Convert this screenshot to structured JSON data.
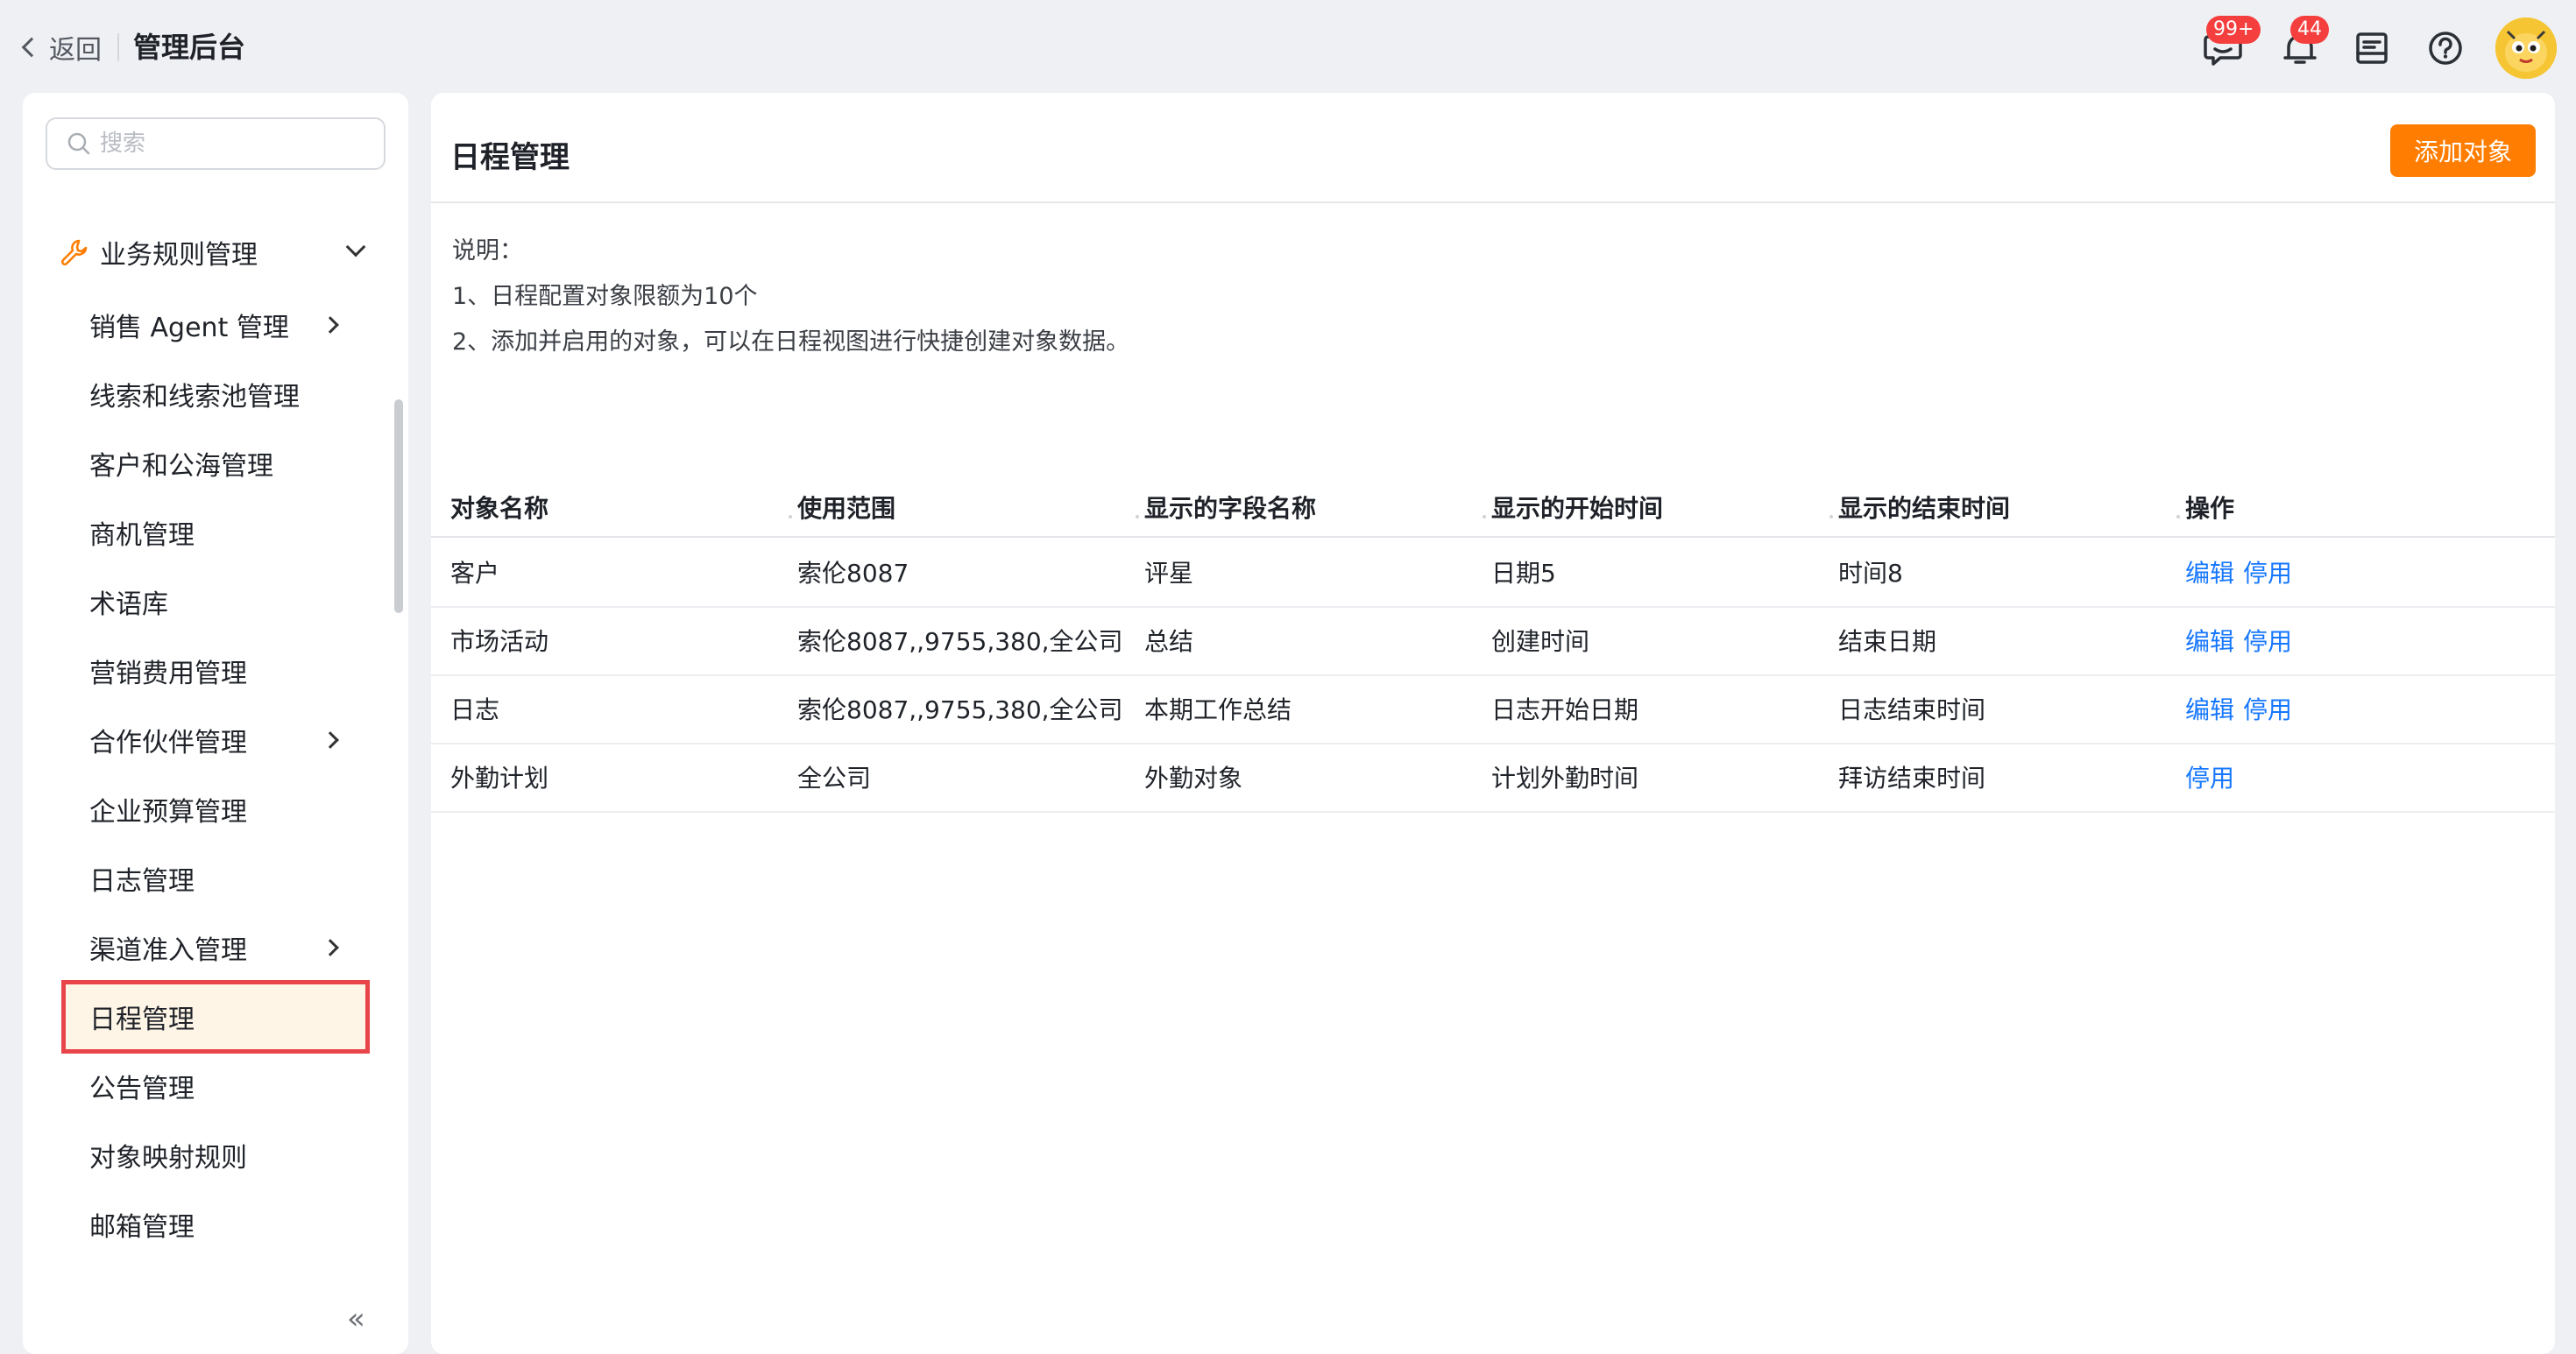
{
  "topbar": {
    "back_label": "返回",
    "title": "管理后台",
    "message_badge": "99+",
    "notice_badge": "44"
  },
  "sidebar": {
    "search_placeholder": "搜索",
    "group_label": "业务规则管理",
    "items": [
      {
        "label": "销售 Agent 管理",
        "has_children": true
      },
      {
        "label": "线索和线索池管理",
        "has_children": false
      },
      {
        "label": "客户和公海管理",
        "has_children": false
      },
      {
        "label": "商机管理",
        "has_children": false
      },
      {
        "label": "术语库",
        "has_children": false
      },
      {
        "label": "营销费用管理",
        "has_children": false
      },
      {
        "label": "合作伙伴管理",
        "has_children": true
      },
      {
        "label": "企业预算管理",
        "has_children": false
      },
      {
        "label": "日志管理",
        "has_children": false
      },
      {
        "label": "渠道准入管理",
        "has_children": true
      },
      {
        "label": "日程管理",
        "has_children": false,
        "active": true
      },
      {
        "label": "公告管理",
        "has_children": false
      },
      {
        "label": "对象映射规则",
        "has_children": false
      },
      {
        "label": "邮箱管理",
        "has_children": false
      }
    ],
    "collapse_glyph": "«"
  },
  "main": {
    "title": "日程管理",
    "add_button": "添加对象",
    "notes": [
      "说明：",
      "1、日程配置对象限额为10个",
      "2、添加并启用的对象，可以在日程视图进行快捷创建对象数据。"
    ],
    "columns": [
      "对象名称",
      "使用范围",
      "显示的字段名称",
      "显示的开始时间",
      "显示的结束时间",
      "操作"
    ],
    "rows": [
      {
        "name": "客户",
        "scope": "索伦8087",
        "field": "评星",
        "start": "日期5",
        "end": "时间8",
        "edit": "编辑",
        "disable": "停用"
      },
      {
        "name": "市场活动",
        "scope": "索伦8087,,9755,380,全公司",
        "field": "总结",
        "start": "创建时间",
        "end": "结束日期",
        "edit": "编辑",
        "disable": "停用"
      },
      {
        "name": "日志",
        "scope": "索伦8087,,9755,380,全公司",
        "field": "本期工作总结",
        "start": "日志开始日期",
        "end": "日志结束时间",
        "edit": "编辑",
        "disable": "停用"
      },
      {
        "name": "外勤计划",
        "scope": "全公司",
        "field": "外勤对象",
        "start": "计划外勤时间",
        "end": "拜访结束时间",
        "edit": "",
        "disable": "停用"
      }
    ]
  },
  "colors": {
    "accent": "#ff7d00",
    "link": "#1677ff",
    "active_bg": "#fff5e6",
    "active_border": "#e8454a",
    "badge": "#f53f3f"
  }
}
